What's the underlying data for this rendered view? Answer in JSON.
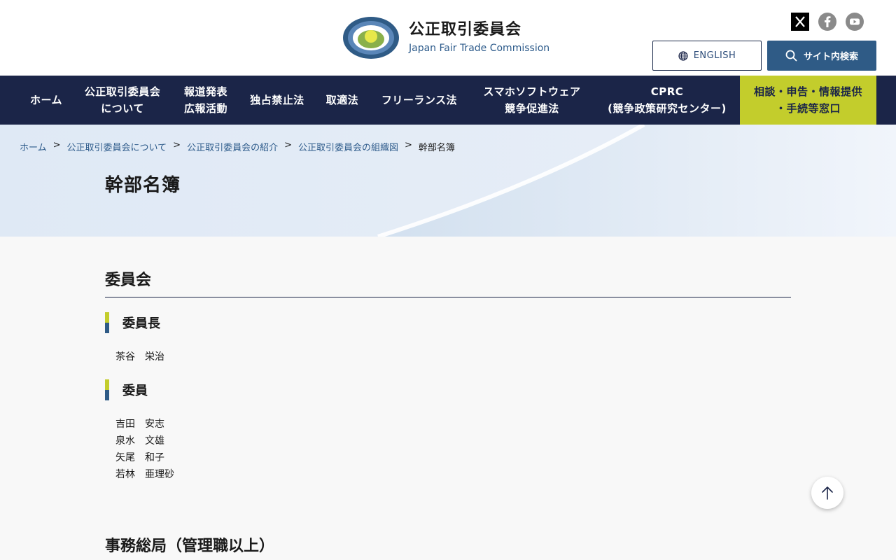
{
  "header": {
    "logo_title": "公正取引委員会",
    "logo_subtitle": "Japan Fair Trade Commission",
    "english_label": "ENGLISH",
    "search_label": "サイト内検索"
  },
  "social": [
    {
      "name": "x-icon"
    },
    {
      "name": "facebook-icon"
    },
    {
      "name": "youtube-icon"
    }
  ],
  "nav": {
    "items": [
      {
        "label": "ホーム"
      },
      {
        "label": "公正取引委員会\nについて"
      },
      {
        "label": "報道発表\n広報活動"
      },
      {
        "label": "独占禁止法"
      },
      {
        "label": "取適法"
      },
      {
        "label": "フリーランス法"
      },
      {
        "label": "スマホソフトウェア\n競争促進法"
      },
      {
        "label": "CPRC\n(競争政策研究センター)"
      },
      {
        "label": "相談・申告・情報提供\n・手続等窓口"
      }
    ]
  },
  "breadcrumb": {
    "items": [
      "ホーム",
      "公正取引委員会について",
      "公正取引委員会の紹介",
      "公正取引委員会の組織図"
    ],
    "separator": ">",
    "current": "幹部名簿"
  },
  "page": {
    "title": "幹部名簿"
  },
  "sections": {
    "committee": {
      "title": "委員会",
      "chair": {
        "heading": "委員長",
        "names": [
          "茶谷　栄治"
        ]
      },
      "members": {
        "heading": "委員",
        "names": [
          "吉田　安志",
          "泉水　文雄",
          "矢尾　和子",
          "若林　亜理砂"
        ]
      }
    },
    "secretariat": {
      "title": "事務総局（管理職以上）"
    }
  },
  "colors": {
    "navy": "#1b2548",
    "accent_green": "#c3cd2c",
    "accent_blue": "#2f5b86",
    "link": "#2c5a8a"
  }
}
